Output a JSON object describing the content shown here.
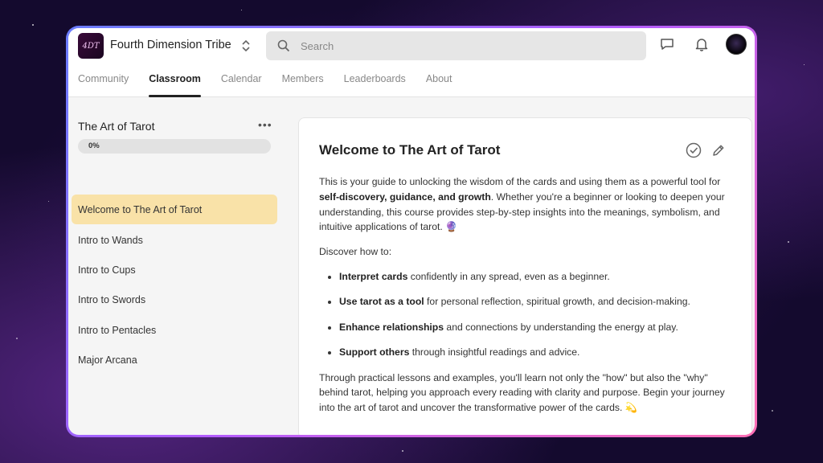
{
  "header": {
    "logo_text": "4DT",
    "group_name": "Fourth Dimension Tribe",
    "search_placeholder": "Search",
    "tabs": [
      {
        "label": "Community"
      },
      {
        "label": "Classroom"
      },
      {
        "label": "Calendar"
      },
      {
        "label": "Members"
      },
      {
        "label": "Leaderboards"
      },
      {
        "label": "About"
      }
    ],
    "active_tab": "Classroom",
    "icons": [
      "chat-icon",
      "bell-icon",
      "avatar"
    ]
  },
  "sidebar": {
    "course_title": "The Art of Tarot",
    "progress_label": "0%",
    "progress_value": 0,
    "lessons": [
      {
        "label": "Welcome to The Art of Tarot",
        "active": true
      },
      {
        "label": "Intro to Wands",
        "active": false
      },
      {
        "label": "Intro to Cups",
        "active": false
      },
      {
        "label": "Intro to Swords",
        "active": false
      },
      {
        "label": "Intro to Pentacles",
        "active": false
      },
      {
        "label": "Major Arcana",
        "active": false
      }
    ]
  },
  "lesson": {
    "title": "Welcome to The Art of Tarot",
    "intro_a": "This is your guide to unlocking the wisdom of the cards and using them as a powerful tool for ",
    "intro_bold": "self-discovery, guidance, and growth",
    "intro_b": ". Whether you're a beginner or looking to deepen your understanding, this course provides step-by-step insights into the meanings, symbolism, and intuitive applications of tarot. 🔮",
    "discover": "Discover how to:",
    "bullets": [
      {
        "bold": "Interpret cards",
        "text": " confidently in any spread, even as a beginner."
      },
      {
        "bold": "Use tarot as a tool",
        "text": " for personal reflection, spiritual growth, and decision-making."
      },
      {
        "bold": "Enhance relationships",
        "text": " and connections by understanding the energy at play."
      },
      {
        "bold": "Support others",
        "text": " through insightful readings and advice."
      }
    ],
    "closing": "Through practical lessons and examples, you'll learn not only the \"how\" but also the \"why\" behind tarot, helping you approach every reading with clarity and purpose. Begin your journey into the art of tarot and uncover the transformative power of the cards. 💫"
  },
  "colors": {
    "active_lesson": "#f9e2a8",
    "frame_gradient": [
      "#6a7dff",
      "#b25cff",
      "#ff6fb5"
    ]
  }
}
